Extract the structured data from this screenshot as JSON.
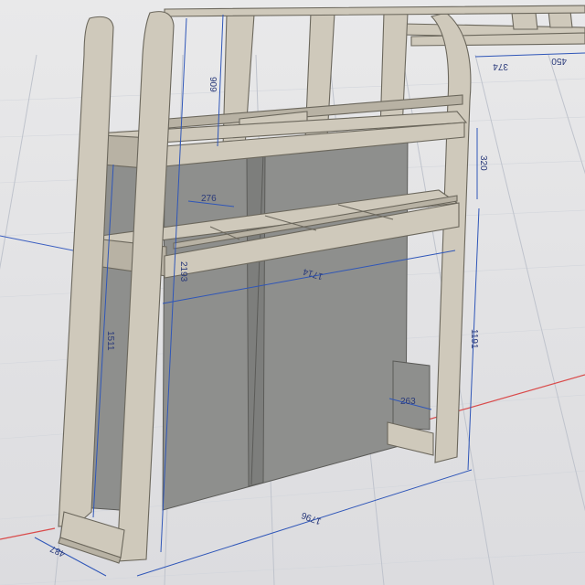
{
  "app": {
    "title": "",
    "view": "3D model viewport"
  },
  "colors": {
    "background": "#e3e3e5",
    "grid": "#bfc3cc",
    "dimension": "#2f56b8",
    "wood": "#cfc9bb",
    "panel": "#8e8f8d",
    "axis_red": "#d94a4a"
  },
  "dimensions": {
    "top_cell_height": "909",
    "shelf_gap": "320",
    "slat_spacing": "276",
    "overall_height": "2193",
    "inner_width": "1714",
    "side_height": "1511",
    "right_height": "1191",
    "foot_depth": "263",
    "base_width": "1796",
    "depth": "487",
    "far_a": "374",
    "far_b": "450"
  }
}
